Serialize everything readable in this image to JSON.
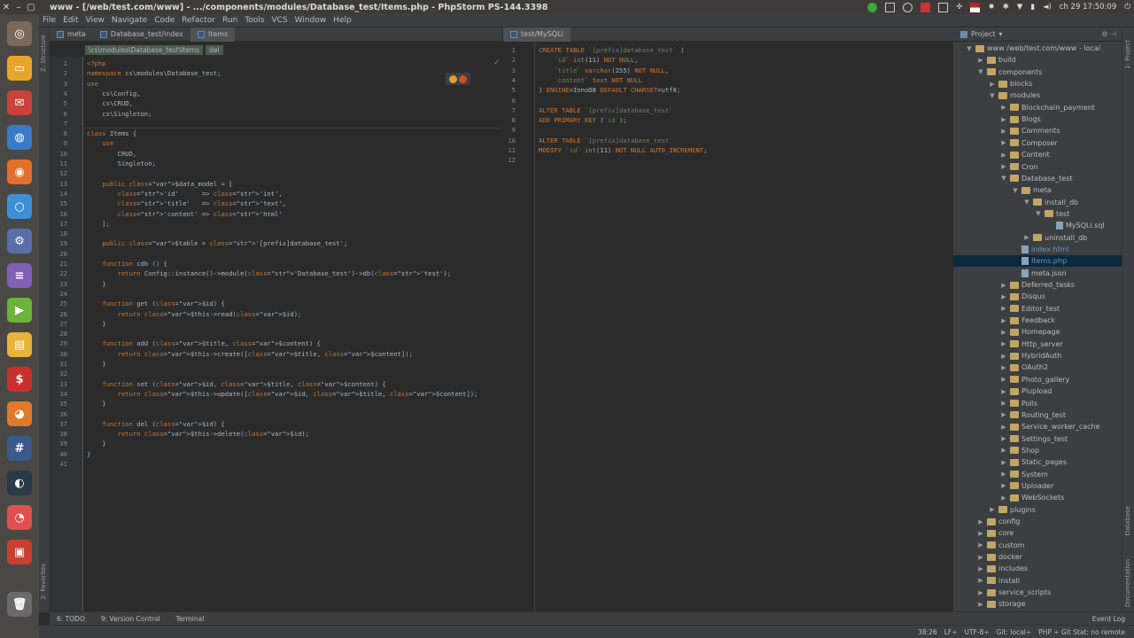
{
  "window": {
    "title": "www - [/web/test.com/www] - .../components/modules/Database_test/Items.php - PhpStorm PS-144.3398",
    "clock": "сh 29 17:50:09"
  },
  "menu": [
    "File",
    "Edit",
    "View",
    "Navigate",
    "Code",
    "Refactor",
    "Run",
    "Tools",
    "VCS",
    "Window",
    "Help"
  ],
  "editor_tabs_left": [
    {
      "label": "meta",
      "active": false
    },
    {
      "label": "Database_test/index",
      "active": false
    },
    {
      "label": "Items",
      "active": true
    }
  ],
  "editor_tabs_right": [
    {
      "label": "test/MySQLi",
      "active": true
    }
  ],
  "breadcrumb": [
    "\\cs\\modules\\Database_test\\Items",
    "del"
  ],
  "left_strip": {
    "structure": "Z: Structure",
    "favorites": "2: Favorites"
  },
  "right_strip": {
    "project": "1: Project",
    "database": "Database",
    "documentation": "Documentation"
  },
  "code_left": [
    "<?php",
    "namespace cs\\modules\\Database_test;",
    "use",
    "    cs\\Config,",
    "    cs\\CRUD,",
    "    cs\\Singleton;",
    "",
    "class Items {",
    "    use",
    "        CRUD,",
    "        Singleton;",
    "",
    "    public $data_model = [",
    "        'id'      => 'int',",
    "        'title'   => 'text',",
    "        'content' => 'html'",
    "    ];",
    "",
    "    public $table = '[prefix]database_test';",
    "",
    "    function cdb () {",
    "        return Config::instance()->module('Database_test')->db('test');",
    "    }",
    "",
    "    function get ($id) {",
    "        return $this->read($id);",
    "    }",
    "",
    "    function add ($title, $content) {",
    "        return $this->create([$title, $content]);",
    "    }",
    "",
    "    function set ($id, $title, $content) {",
    "        return $this->update([$id, $title, $content]);",
    "    }",
    "",
    "    function del ($id) {",
    "        return $this->delete($id);",
    "    }",
    "}",
    ""
  ],
  "code_right": [
    "CREATE TABLE `[prefix]database_test` (",
    "    `id` int(11) NOT NULL,",
    "    `title` varchar(255) NOT NULL,",
    "    `content` text NOT NULL",
    ") ENGINE=InnoDB DEFAULT CHARSET=utf8;",
    "",
    "ALTER TABLE `[prefix]database_test`",
    "ADD PRIMARY KEY (`id`);",
    "",
    "ALTER TABLE `[prefix]database_test`",
    "MODIFY `id` int(11) NOT NULL AUTO_INCREMENT;",
    ""
  ],
  "project": {
    "header": "Project",
    "tree": [
      {
        "label": "www /web/test.com/www - local",
        "depth": 0,
        "arrow": "down",
        "kind": "root"
      },
      {
        "label": "build",
        "depth": 1,
        "arrow": "right",
        "kind": "folder"
      },
      {
        "label": "components",
        "depth": 1,
        "arrow": "down",
        "kind": "folder"
      },
      {
        "label": "blocks",
        "depth": 2,
        "arrow": "right",
        "kind": "folder"
      },
      {
        "label": "modules",
        "depth": 2,
        "arrow": "down",
        "kind": "folder"
      },
      {
        "label": "Blockchain_payment",
        "depth": 3,
        "arrow": "right",
        "kind": "folder"
      },
      {
        "label": "Blogs",
        "depth": 3,
        "arrow": "right",
        "kind": "folder"
      },
      {
        "label": "Comments",
        "depth": 3,
        "arrow": "right",
        "kind": "folder"
      },
      {
        "label": "Composer",
        "depth": 3,
        "arrow": "right",
        "kind": "folder"
      },
      {
        "label": "Content",
        "depth": 3,
        "arrow": "right",
        "kind": "folder"
      },
      {
        "label": "Cron",
        "depth": 3,
        "arrow": "right",
        "kind": "folder"
      },
      {
        "label": "Database_test",
        "depth": 3,
        "arrow": "down",
        "kind": "folder"
      },
      {
        "label": "meta",
        "depth": 4,
        "arrow": "down",
        "kind": "folder"
      },
      {
        "label": "install_db",
        "depth": 5,
        "arrow": "down",
        "kind": "folder"
      },
      {
        "label": "test",
        "depth": 6,
        "arrow": "down",
        "kind": "folder"
      },
      {
        "label": "MySQLi.sql",
        "depth": 7,
        "arrow": "",
        "kind": "file"
      },
      {
        "label": "uninstall_db",
        "depth": 5,
        "arrow": "right",
        "kind": "folder"
      },
      {
        "label": "index.html",
        "depth": 4,
        "arrow": "",
        "kind": "file",
        "color": "#6897bb"
      },
      {
        "label": "Items.php",
        "depth": 4,
        "arrow": "",
        "kind": "file",
        "color": "#6897bb",
        "selected": true
      },
      {
        "label": "meta.json",
        "depth": 4,
        "arrow": "",
        "kind": "file"
      },
      {
        "label": "Deferred_tasks",
        "depth": 3,
        "arrow": "right",
        "kind": "folder"
      },
      {
        "label": "Disqus",
        "depth": 3,
        "arrow": "right",
        "kind": "folder"
      },
      {
        "label": "Editor_test",
        "depth": 3,
        "arrow": "right",
        "kind": "folder"
      },
      {
        "label": "Feedback",
        "depth": 3,
        "arrow": "right",
        "kind": "folder"
      },
      {
        "label": "Homepage",
        "depth": 3,
        "arrow": "right",
        "kind": "folder"
      },
      {
        "label": "Http_server",
        "depth": 3,
        "arrow": "right",
        "kind": "folder"
      },
      {
        "label": "HybridAuth",
        "depth": 3,
        "arrow": "right",
        "kind": "folder"
      },
      {
        "label": "OAuth2",
        "depth": 3,
        "arrow": "right",
        "kind": "folder"
      },
      {
        "label": "Photo_gallery",
        "depth": 3,
        "arrow": "right",
        "kind": "folder"
      },
      {
        "label": "Plupload",
        "depth": 3,
        "arrow": "right",
        "kind": "folder"
      },
      {
        "label": "Polls",
        "depth": 3,
        "arrow": "right",
        "kind": "folder"
      },
      {
        "label": "Routing_test",
        "depth": 3,
        "arrow": "right",
        "kind": "folder"
      },
      {
        "label": "Service_worker_cache",
        "depth": 3,
        "arrow": "right",
        "kind": "folder"
      },
      {
        "label": "Settings_test",
        "depth": 3,
        "arrow": "right",
        "kind": "folder"
      },
      {
        "label": "Shop",
        "depth": 3,
        "arrow": "right",
        "kind": "folder"
      },
      {
        "label": "Static_pages",
        "depth": 3,
        "arrow": "right",
        "kind": "folder"
      },
      {
        "label": "System",
        "depth": 3,
        "arrow": "right",
        "kind": "folder"
      },
      {
        "label": "Uploader",
        "depth": 3,
        "arrow": "right",
        "kind": "folder"
      },
      {
        "label": "WebSockets",
        "depth": 3,
        "arrow": "right",
        "kind": "folder"
      },
      {
        "label": "plugins",
        "depth": 2,
        "arrow": "right",
        "kind": "folder"
      },
      {
        "label": "config",
        "depth": 1,
        "arrow": "right",
        "kind": "folder"
      },
      {
        "label": "core",
        "depth": 1,
        "arrow": "right",
        "kind": "folder"
      },
      {
        "label": "custom",
        "depth": 1,
        "arrow": "right",
        "kind": "folder"
      },
      {
        "label": "docker",
        "depth": 1,
        "arrow": "right",
        "kind": "folder"
      },
      {
        "label": "includes",
        "depth": 1,
        "arrow": "right",
        "kind": "folder"
      },
      {
        "label": "install",
        "depth": 1,
        "arrow": "right",
        "kind": "folder"
      },
      {
        "label": "service_scripts",
        "depth": 1,
        "arrow": "right",
        "kind": "folder"
      },
      {
        "label": "storage",
        "depth": 1,
        "arrow": "right",
        "kind": "folder"
      }
    ]
  },
  "bottom_tools": [
    "6: TODO",
    "9: Version Control",
    "Terminal"
  ],
  "event_log": "Event Log",
  "status": [
    "38:26",
    "LF÷",
    "UTF-8÷",
    "Git: local÷",
    "PHP ÷ Git Stat: no remote"
  ],
  "launcher": [
    {
      "name": "ubuntu-dash-icon",
      "color": "#7a6a5a",
      "glyph": "◎"
    },
    {
      "name": "files-icon",
      "color": "#e8a42c",
      "glyph": "▭"
    },
    {
      "name": "mail-icon",
      "color": "#c8413a",
      "glyph": "✉"
    },
    {
      "name": "browser-icon",
      "color": "#3a7bc8",
      "glyph": "◍"
    },
    {
      "name": "firefox-icon",
      "color": "#e46f2a",
      "glyph": "◉"
    },
    {
      "name": "chromium-icon",
      "color": "#3f8fd8",
      "glyph": "○"
    },
    {
      "name": "settings-app-icon",
      "color": "#5a6ea8",
      "glyph": "⚙"
    },
    {
      "name": "text-editor-icon",
      "color": "#7f5fb8",
      "glyph": "≡"
    },
    {
      "name": "media-player-icon",
      "color": "#6cb33a",
      "glyph": "▶"
    },
    {
      "name": "archive-icon",
      "color": "#e8b23c",
      "glyph": "▤"
    },
    {
      "name": "terminal-icon",
      "color": "#c9302c",
      "glyph": "$"
    },
    {
      "name": "basketball-app-icon",
      "color": "#e07a2a",
      "glyph": "◕"
    },
    {
      "name": "hashtag-app-icon",
      "color": "#3a5a8a",
      "glyph": "#"
    },
    {
      "name": "steam-icon",
      "color": "#2a3a4a",
      "glyph": "◐"
    },
    {
      "name": "pie-app-icon",
      "color": "#e05050",
      "glyph": "◔"
    },
    {
      "name": "software-center-icon",
      "color": "#c84030",
      "glyph": "▣"
    }
  ],
  "trash_label": "Trash"
}
